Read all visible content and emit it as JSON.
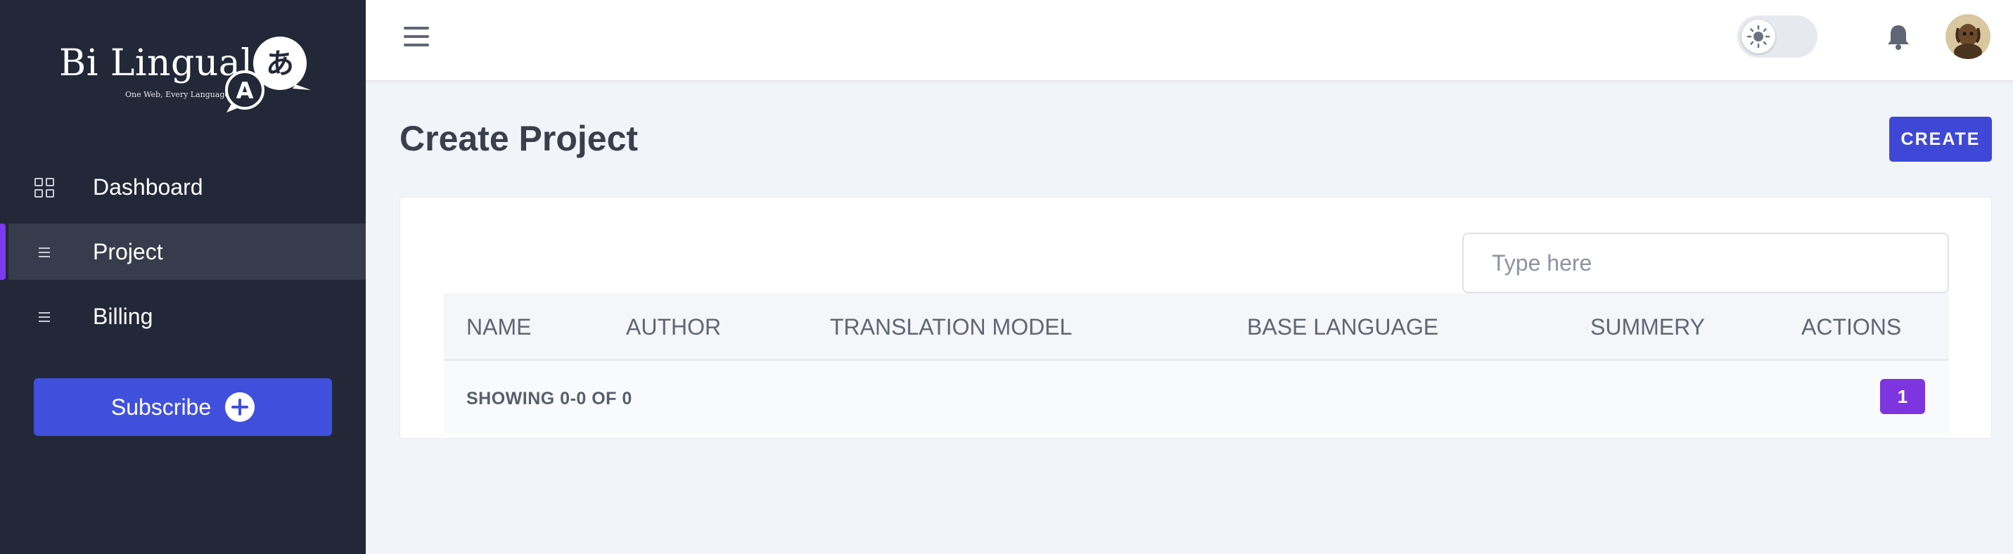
{
  "brand": {
    "name": "Bi Lingual",
    "tagline": "One Web, Every Language",
    "bubble_front": "A",
    "bubble_back": "あ"
  },
  "sidebar": {
    "items": [
      {
        "label": "Dashboard",
        "icon": "grid-icon",
        "active": false
      },
      {
        "label": "Project",
        "icon": "menu-lines-icon",
        "active": true
      },
      {
        "label": "Billing",
        "icon": "menu-lines-icon",
        "active": false
      }
    ],
    "subscribe_label": "Subscribe",
    "subscribe_icon": "plus-circle-icon"
  },
  "topbar": {
    "menu_icon": "hamburger-icon",
    "theme_toggle_icon": "sun-icon",
    "notification_icon": "bell-icon",
    "avatar_icon": "user-avatar"
  },
  "main": {
    "title": "Create Project",
    "create_label": "CREATE",
    "search_placeholder": "Type here",
    "table": {
      "columns": [
        "NAME",
        "AUTHOR",
        "TRANSLATION MODEL",
        "BASE LANGUAGE",
        "SUMMERY",
        "ACTIONS"
      ],
      "rows": [],
      "showing": "SHOWING 0-0 OF 0",
      "current_page": "1"
    }
  },
  "colors": {
    "sidebar_bg": "#222838",
    "accent": "#4150dc",
    "active_indicator": "#7c3aed",
    "page_button": "#7e35e0",
    "page_bg": "#f1f4f9"
  }
}
